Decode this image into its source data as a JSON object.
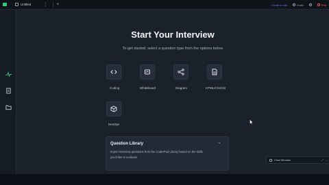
{
  "app": {
    "tab_title": "Untitled",
    "tab_menu": "⋮",
    "new_tab": "+"
  },
  "toolbar": {
    "link_text": "• Invite a user",
    "item_label": "Invite",
    "end_label": "End",
    "colors": {
      "accent": "#6b7cf6",
      "danger": "#ff5a5a",
      "active": "#2ecc71"
    }
  },
  "rail": {
    "items": [
      {
        "icon": "activity-icon",
        "active": true
      },
      {
        "icon": "document-icon",
        "active": false
      },
      {
        "icon": "folder-icon",
        "active": false
      }
    ]
  },
  "main": {
    "title": "Start Your Interview",
    "subtitle": "To get started, select a question type from the options below",
    "options": [
      {
        "label": "Coding",
        "icon": "code-icon"
      },
      {
        "label": "Whiteboard",
        "icon": "whiteboard-icon"
      },
      {
        "label": "Diagram",
        "icon": "diagram-icon"
      },
      {
        "label": "HTML/CSS/JS",
        "icon": "html-file-icon"
      },
      {
        "label": "DevOps",
        "icon": "devops-cube-icon"
      }
    ],
    "library": {
      "title": "Question Library",
      "arrow": "→",
      "description": "Import interview questions from the CoderPad Library based on the skills you'd like to evaluate."
    }
  },
  "chat": {
    "label": "Chat Window",
    "controls": [
      "⤢",
      "—"
    ]
  }
}
